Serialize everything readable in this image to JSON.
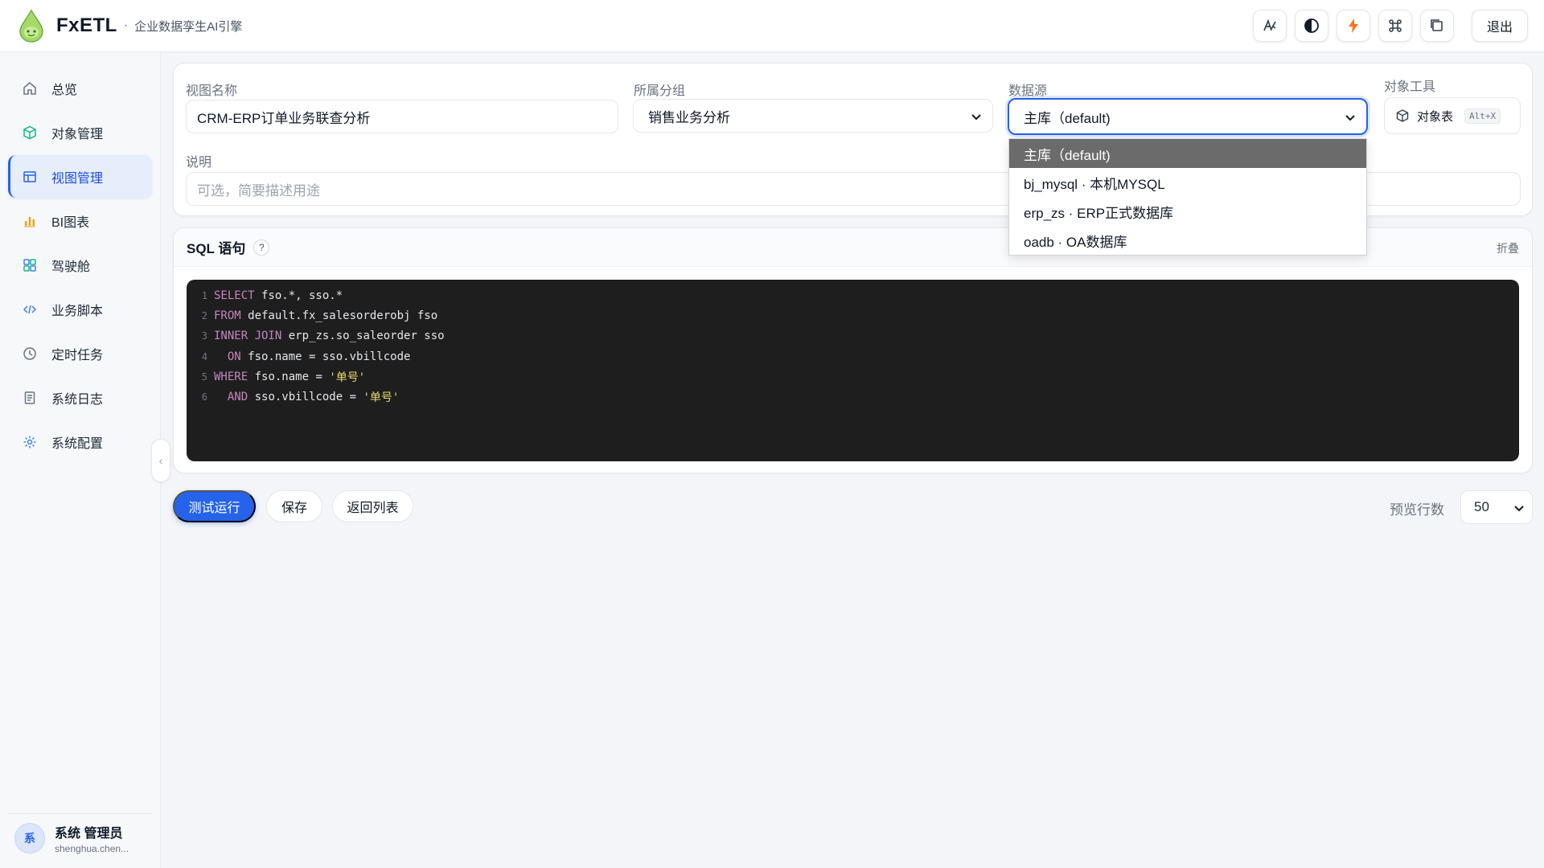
{
  "app": {
    "name": "FxETL",
    "separator": "·",
    "tagline": "企业数据孪生AI引擎"
  },
  "topbar": {
    "actions": [
      {
        "icon": "text-style-icon",
        "glyph": "A⁄"
      },
      {
        "icon": "contrast-icon",
        "glyph": "◐"
      },
      {
        "icon": "lightning-icon",
        "glyph": "ϟ"
      },
      {
        "icon": "command-icon",
        "glyph": "⌘"
      },
      {
        "icon": "window-icon",
        "glyph": "❐"
      }
    ],
    "logout_label": "退出"
  },
  "sidebar": {
    "items": [
      {
        "label": "总览",
        "icon": "home-icon"
      },
      {
        "label": "对象管理",
        "icon": "cube-icon"
      },
      {
        "label": "视图管理",
        "icon": "table-icon",
        "active": true
      },
      {
        "label": "BI图表",
        "icon": "bar-chart-icon"
      },
      {
        "label": "驾驶舱",
        "icon": "dashboard-icon"
      },
      {
        "label": "业务脚本",
        "icon": "code-icon"
      },
      {
        "label": "定时任务",
        "icon": "clock-icon"
      },
      {
        "label": "系统日志",
        "icon": "document-icon"
      },
      {
        "label": "系统配置",
        "icon": "gear-icon"
      }
    ],
    "collapse_glyph": "‹",
    "user": {
      "avatar_text": "系",
      "name": "系统 管理员",
      "email": "shenghua.chen..."
    }
  },
  "form": {
    "view_name_label": "视图名称",
    "view_name_value": "CRM-ERP订单业务联查分析",
    "group_label": "所属分组",
    "group_value": "销售业务分析",
    "datasource_label": "数据源",
    "datasource_value": "主库（default)",
    "object_tools_label": "对象工具",
    "object_table_label": "对象表",
    "object_table_shortcut": "Alt+X",
    "description_label": "说明",
    "description_placeholder": "可选，简要描述用途"
  },
  "datasource_options": [
    "主库（default)",
    "bj_mysql · 本机MYSQL",
    "erp_zs · ERP正式数据库",
    "oadb · OA数据库"
  ],
  "sql": {
    "title": "SQL 语句",
    "help": "?",
    "fold_label": "折叠",
    "lines": [
      {
        "n": "1",
        "kw": "SELECT",
        "rest": " fso.*, sso.*"
      },
      {
        "n": "2",
        "kw": "FROM",
        "rest": " default.fx_salesorderobj fso"
      },
      {
        "n": "3",
        "kw": "INNER JOIN",
        "rest": " erp_zs.so_saleorder sso"
      },
      {
        "n": "4",
        "kw": "  ON",
        "rest": " fso.name = sso.vbillcode"
      },
      {
        "n": "5",
        "kw": "WHERE",
        "rest": " fso.name = ",
        "str": "'单号'"
      },
      {
        "n": "6",
        "kw": "  AND",
        "rest": " sso.vbillcode = ",
        "str": "'单号'"
      }
    ]
  },
  "actions": {
    "test_run": "测试运行",
    "save": "保存",
    "back": "返回列表",
    "preview_rows_label": "预览行数",
    "preview_rows_value": "50"
  },
  "colors": {
    "primary": "#2563eb",
    "code_bg": "#1e1e1e",
    "keyword": "#c586c0",
    "string": "#e6db74"
  }
}
